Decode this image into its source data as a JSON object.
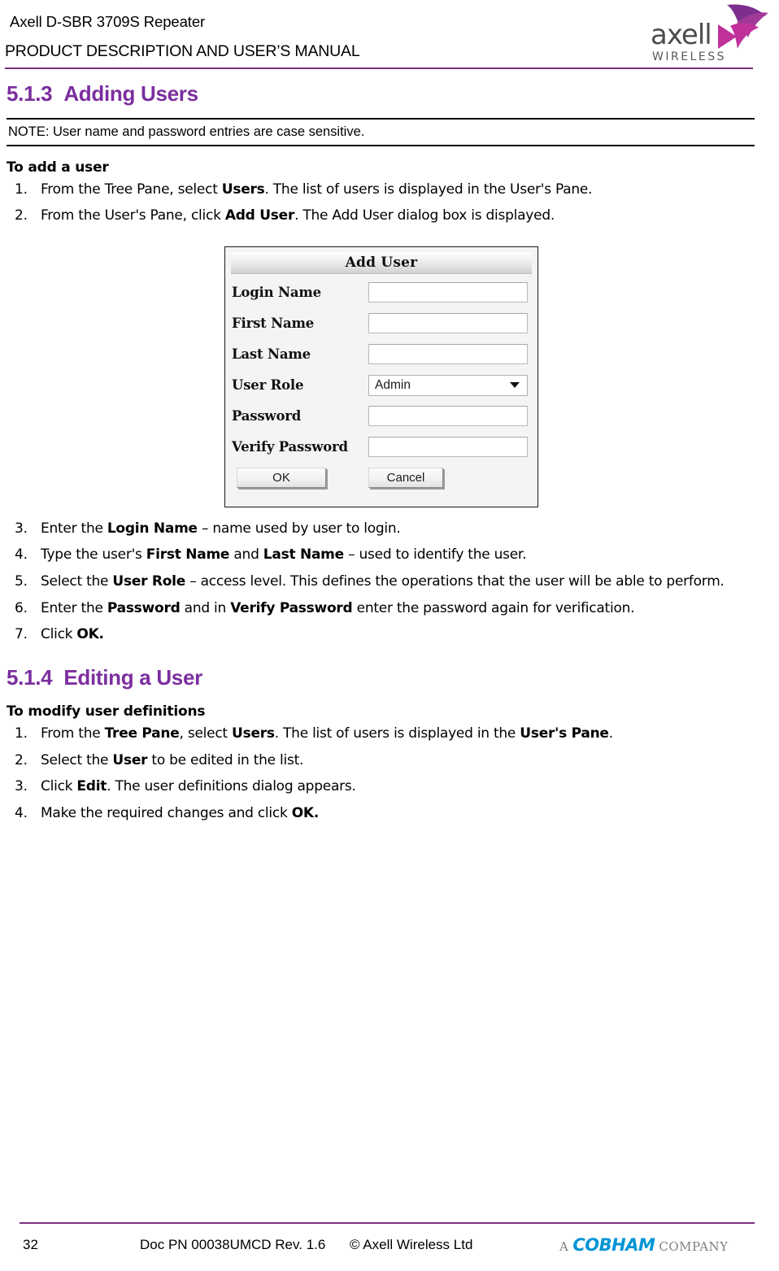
{
  "header": {
    "product_line": "Axell D-SBR 3709S Repeater",
    "manual_line": "PRODUCT DESCRIPTION AND USER’S MANUAL",
    "logo_name": "axell",
    "logo_subtext": "WIRELESS",
    "rule_color": "#7B2E7E"
  },
  "sections": {
    "adding_users": {
      "number": "5.1.3",
      "title": "Adding Users",
      "color": "#7B2E9E",
      "note": "NOTE: User name and password entries are case sensitive.",
      "subhead": "To add a user",
      "steps_before": [
        {
          "marker": "1.",
          "html": "From the Tree Pane, select <b>Users</b>. The list of users is displayed in the User's Pane."
        },
        {
          "marker": "2.",
          "html": "From the User's Pane, click <b>Add User</b>. The Add User dialog box is displayed."
        }
      ],
      "steps_after": [
        {
          "marker": "3.",
          "html": "Enter the <b>Login Name</b> – name used by user to login."
        },
        {
          "marker": "4.",
          "html": "Type the user's <b>First Name</b> and <b>Last Name</b> – used to identify the user."
        },
        {
          "marker": "5.",
          "html": "Select the <b>User Role</b> – access level. This defines the operations that the user will be able to perform."
        },
        {
          "marker": "6.",
          "html": "Enter the <b>Password</b> and in <b>Verify Password</b> enter the password again for verification."
        },
        {
          "marker": "7.",
          "html": "Click <b>OK.</b>"
        }
      ]
    },
    "editing_user": {
      "number": "5.1.4",
      "title": "Editing a User",
      "color": "#7B2E9E",
      "subhead": "To modify user definitions",
      "steps": [
        {
          "marker": "1.",
          "html": "From the <b>Tree Pane</b>, select <b>Users</b>. The list of users is displayed in the <b>User's Pane</b>."
        },
        {
          "marker": "2.",
          "html": "Select the <b>User</b> to be edited in the list."
        },
        {
          "marker": "3.",
          "html": "Click <b>Edit</b>. The user definitions dialog appears."
        },
        {
          "marker": "4.",
          "html": "Make the required changes and click <b>OK.</b>"
        }
      ]
    }
  },
  "add_user_dialog": {
    "title": "Add User",
    "fields": [
      {
        "label": "Login Name",
        "type": "text",
        "value": "",
        "placeholder": ""
      },
      {
        "label": "First Name",
        "type": "text",
        "value": "",
        "placeholder": ""
      },
      {
        "label": "Last Name",
        "type": "text",
        "value": "",
        "placeholder": ""
      },
      {
        "label": "User Role",
        "type": "select",
        "value": "Admin",
        "options": [
          "Admin"
        ]
      },
      {
        "label": "Password",
        "type": "text",
        "value": "",
        "placeholder": ""
      },
      {
        "label": "Verify Password",
        "type": "text",
        "value": "",
        "placeholder": ""
      }
    ],
    "ok_label": "OK",
    "cancel_label": "Cancel"
  },
  "footer": {
    "page_number": "32",
    "doc_reference": "Doc PN 00038UMCD Rev. 1.6",
    "copyright": "© Axell Wireless Ltd",
    "cobham_prefix": "A",
    "cobham_name": "COBHAM",
    "cobham_suffix": "COMPANY",
    "cobham_color": "#0094D6",
    "rule_color": "#7B2E7E"
  }
}
